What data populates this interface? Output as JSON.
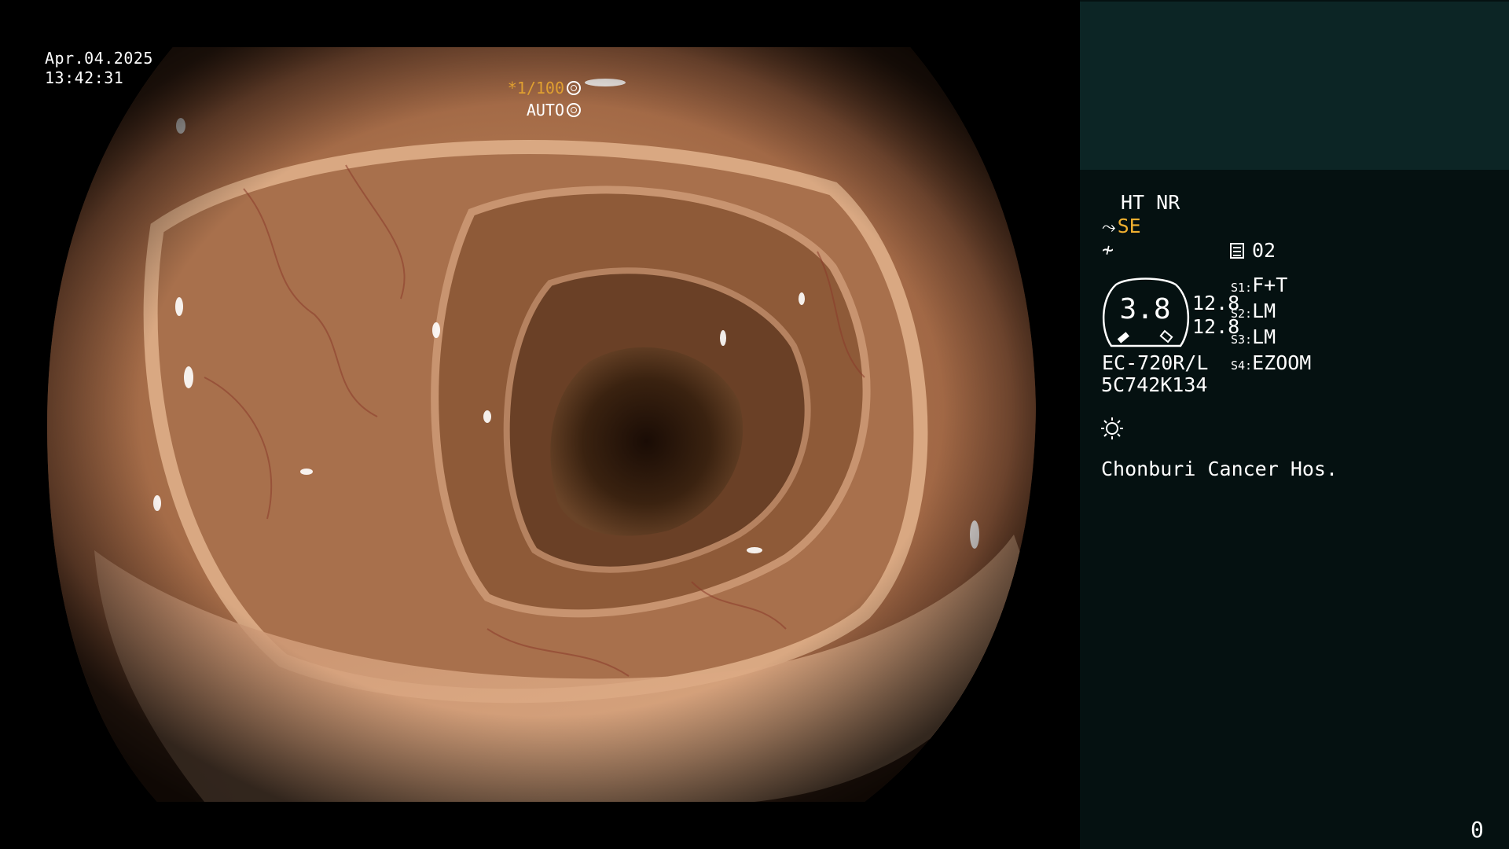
{
  "overlay": {
    "date": "Apr.04.2025",
    "time": "13:42:31",
    "shutter_prefix": "*",
    "shutter_value": "1/100",
    "iris_mode": "AUTO",
    "shutter_icon": "aperture-icon",
    "iris_icon": "iris-icon"
  },
  "panel": {
    "modes": "HT NR",
    "structure_enhancement": "SE",
    "structure_icon": "structure-enhancement-icon",
    "enhancement_icon": "enhancement-icon",
    "memory_icon": "memo-icon",
    "memory_number": "02",
    "gauge_value": "3.8",
    "gauge_side_top": "12.8",
    "gauge_side_bottom": "12.8",
    "scope_switches": [
      {
        "tag": "S1:",
        "value": "F+T"
      },
      {
        "tag": "S2:",
        "value": "LM"
      },
      {
        "tag": "S3:",
        "value": "LM"
      },
      {
        "tag": "S4:",
        "value": "EZOOM"
      }
    ],
    "scope_model": "EC-720R/L",
    "scope_serial": "5C742K134",
    "light_icon": "light-source-icon",
    "hospital": "Chonburi Cancer Hos.",
    "frame_counter": "0"
  },
  "colors": {
    "panel_background": "#051111",
    "panel_top_background": "#0c2525",
    "accent_orange": "#f0b030"
  }
}
